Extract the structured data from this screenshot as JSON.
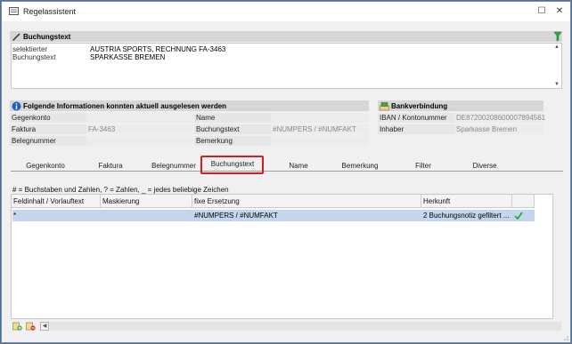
{
  "window": {
    "title": "Regelassistent"
  },
  "controls": {
    "minimize": "—",
    "maximize": "☐",
    "close": "✕"
  },
  "buchungstext_section": {
    "title": "Buchungstext",
    "label_line1": "selektierter",
    "label_line2": "Buchungstext",
    "value_line1": "AUSTRIA SPORTS, RECHNUNG FA-3463",
    "value_line2": "SPARKASSE BREMEN"
  },
  "info_section": {
    "title": "Folgende Informationen konnten aktuell ausgelesen werden",
    "rows": [
      {
        "label1": "Gegenkonto",
        "value1": "",
        "label2": "Name",
        "value2": ""
      },
      {
        "label1": "Faktura",
        "value1": "FA-3463",
        "label2": "Buchungstext",
        "value2": "#NUMPERS / #NUMFAKT"
      },
      {
        "label1": "Belegnummer",
        "value1": "",
        "label2": "Bemerkung",
        "value2": ""
      }
    ]
  },
  "bank_section": {
    "title": "Bankverbindung",
    "rows": [
      {
        "label": "IBAN / Kontonummer",
        "value": "DE87200208600007894561"
      },
      {
        "label": "Inhaber",
        "value": "Sparkasse Bremen"
      }
    ]
  },
  "tabs": [
    "Gegenkonto",
    "Faktura",
    "Belegnummer",
    "Buchungstext",
    "Name",
    "Bemerkung",
    "Filter",
    "Diverse"
  ],
  "active_tab": "Buchungstext",
  "hint": "# = Buchstaben und Zahlen, ? = Zahlen, _ = jedes beliebige Zeichen",
  "table": {
    "headers": [
      "Feldinhalt / Vorlauftext",
      "Maskierung",
      "fixe Ersetzung",
      "Herkunft"
    ],
    "rows": [
      {
        "feldinhalt": "*",
        "maskierung": "",
        "ersetzung": "#NUMPERS / #NUMFAKT",
        "herkunft": "2  Buchungsnotiz gefiltert ..."
      }
    ]
  },
  "colors": {
    "highlight": "#d02020",
    "selection": "#c4d6ee",
    "accent": "#5a8fd8"
  }
}
